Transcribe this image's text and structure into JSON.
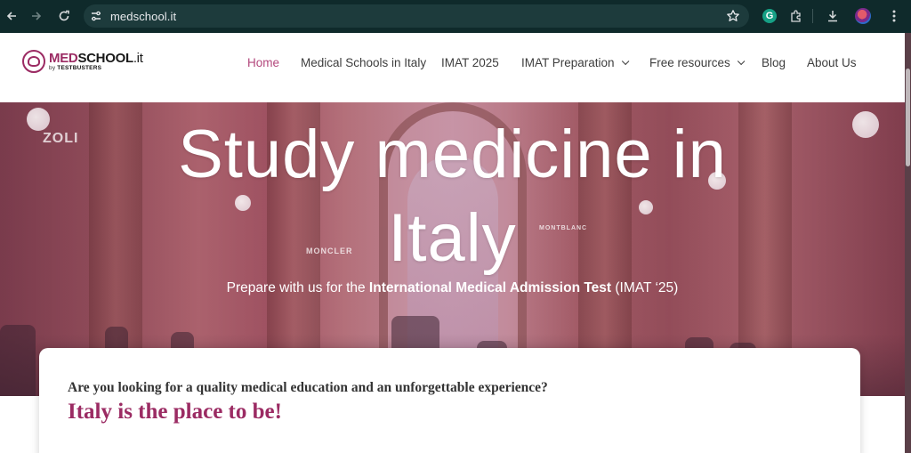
{
  "browser": {
    "url": "medschool.it",
    "icons": [
      "back-arrow-icon",
      "forward-arrow-icon",
      "reload-icon",
      "site-settings-icon",
      "bookmark-star-icon",
      "grammarly-icon",
      "extensions-icon",
      "download-icon",
      "profile-avatar",
      "menu-kebab-icon"
    ],
    "grammarly_letter": "G"
  },
  "site": {
    "logo": {
      "med": "MED",
      "school": "SCHOOL",
      "tld": ".it",
      "by": "by ",
      "brand": "TESTBUSTERS"
    },
    "nav": [
      {
        "label": "Home",
        "active": true
      },
      {
        "label": "Medical Schools in Italy"
      },
      {
        "label": "IMAT 2025"
      },
      {
        "label": "IMAT Preparation",
        "dropdown": true
      },
      {
        "label": "Free resources",
        "dropdown": true
      },
      {
        "label": "Blog"
      },
      {
        "label": "About Us"
      }
    ],
    "accent_color": "#9b2b63"
  },
  "hero": {
    "title_line1": "Study medicine in",
    "title_line2": "Italy",
    "sub_prefix": "Prepare with us for the ",
    "sub_bold": "International Medical Admission Test",
    "sub_suffix": " (IMAT ‘25)",
    "signs": [
      "ZOLI",
      "MONCLER",
      "MONTBLANC"
    ]
  },
  "card": {
    "question": "Are you looking for a quality medical education and an unforgettable experience?",
    "headline": "Italy is the place to be!"
  }
}
